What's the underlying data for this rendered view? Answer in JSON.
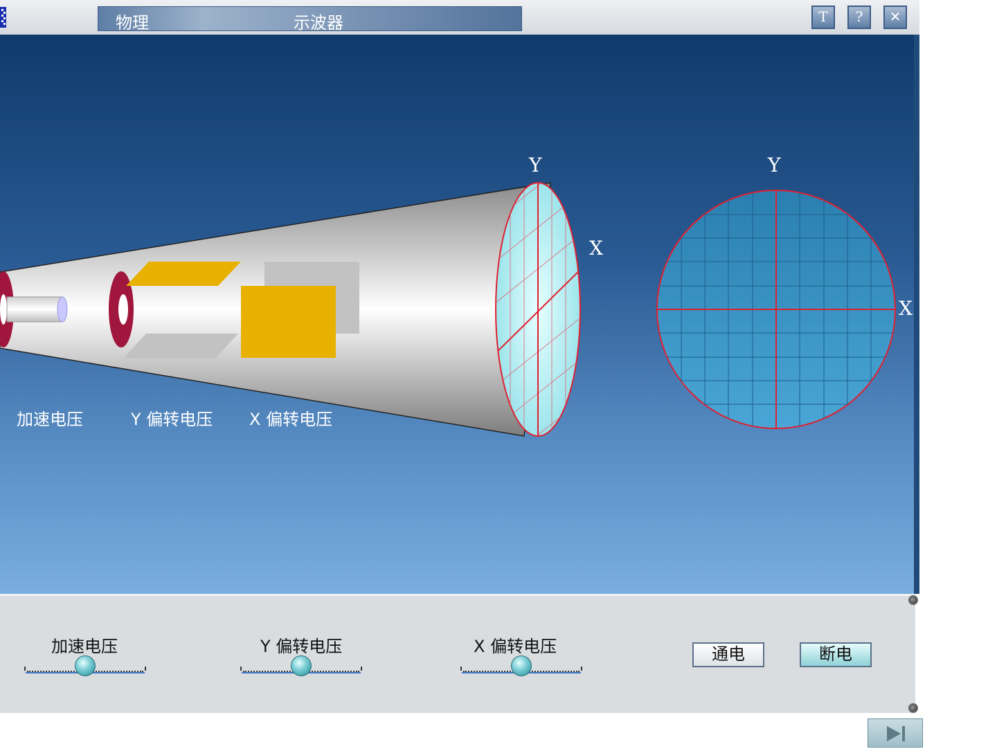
{
  "title_bar": {
    "subject": "物理",
    "topic": "示波器",
    "buttons": [
      {
        "label": "T",
        "icon": "text-icon"
      },
      {
        "label": "?",
        "icon": "help-icon"
      },
      {
        "label": "✕",
        "icon": "close-icon"
      }
    ]
  },
  "simulation": {
    "tube_axis_labels": {
      "y": "Y",
      "x": "X"
    },
    "screen_axis_labels": {
      "y": "Y",
      "x": "X"
    },
    "part_labels": {
      "accelerating": "加速电压",
      "y_deflection": "Y 偏转电压",
      "x_deflection": "X 偏转电压"
    },
    "colors": {
      "plate": "#e8b100",
      "ring": "#a0163c",
      "grid": "#e03040",
      "screen": "#3c90c4"
    }
  },
  "controls": {
    "sliders": [
      {
        "label": "加速电压",
        "value": 0.5
      },
      {
        "label": "Y 偏转电压",
        "value": 0.5
      },
      {
        "label": "X 偏转电压",
        "value": 0.5
      }
    ],
    "power_on_label": "通电",
    "power_off_label": "断电"
  },
  "footer": {
    "next_icon": "skip-next-icon"
  }
}
